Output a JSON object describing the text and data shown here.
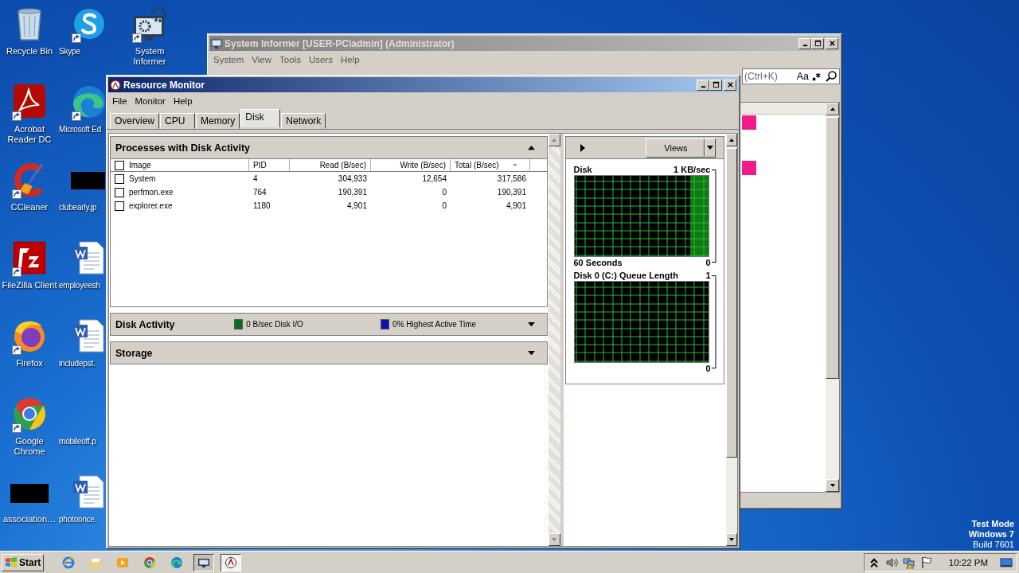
{
  "desktop_icons": [
    {
      "label": "Recycle Bin",
      "shortcut": false
    },
    {
      "label": "Acrobat Reader DC",
      "shortcut": true
    },
    {
      "label": "CCleaner",
      "shortcut": true
    },
    {
      "label": "FileZilla Client",
      "shortcut": true
    },
    {
      "label": "Firefox",
      "shortcut": true
    },
    {
      "label": "Google Chrome",
      "shortcut": true
    },
    {
      "label": "association…",
      "shortcut": false
    },
    {
      "label": "Skype",
      "shortcut": true
    },
    {
      "label": "Microsoft Ed",
      "shortcut": true
    },
    {
      "label": "clubearly.jp",
      "shortcut": false
    },
    {
      "label": "employeesh",
      "shortcut": false
    },
    {
      "label": "includepst.",
      "shortcut": false
    },
    {
      "label": "mobileoff.p",
      "shortcut": false
    },
    {
      "label": "photoonce.",
      "shortcut": false
    },
    {
      "label": "System Informer",
      "shortcut": true
    }
  ],
  "system_informer": {
    "title": "System Informer [USER-PC\\admin] (Administrator)",
    "menu": [
      "System",
      "View",
      "Tools",
      "Users",
      "Help"
    ],
    "search": {
      "placeholder": "(Ctrl+K)",
      "case_label": "Aa"
    },
    "rows": [
      {
        "highlighted": true
      },
      {
        "highlighted": false
      },
      {
        "highlighted": false
      },
      {
        "highlighted": true
      }
    ]
  },
  "resource_monitor": {
    "title": "Resource Monitor",
    "menu": [
      "File",
      "Monitor",
      "Help"
    ],
    "tabs": [
      {
        "label": "Overview",
        "selected": false
      },
      {
        "label": "CPU",
        "selected": false
      },
      {
        "label": "Memory",
        "selected": false
      },
      {
        "label": "Disk",
        "selected": true
      },
      {
        "label": "Network",
        "selected": false
      }
    ],
    "processes": {
      "title": "Processes with Disk Activity",
      "expanded": true,
      "all_checked": false,
      "columns": [
        {
          "label": "Image",
          "sorted": false
        },
        {
          "label": "PID",
          "sorted": false
        },
        {
          "label": "Read (B/sec)",
          "sorted": false
        },
        {
          "label": "Write (B/sec)",
          "sorted": false
        },
        {
          "label": "Total (B/sec)",
          "sorted": true
        }
      ],
      "rows": [
        {
          "checked": false,
          "cells": [
            "System",
            "4",
            "304,933",
            "12,654",
            "317,586"
          ]
        },
        {
          "checked": false,
          "cells": [
            "perfmon.exe",
            "764",
            "190,391",
            "0",
            "190,391"
          ]
        },
        {
          "checked": false,
          "cells": [
            "explorer.exe",
            "1180",
            "4,901",
            "0",
            "4,901"
          ]
        }
      ]
    },
    "disk_activity": {
      "title": "Disk Activity",
      "expanded": false,
      "legend": [
        {
          "label": "0 B/sec Disk I/O",
          "color": "#0b6e1e"
        },
        {
          "label": "0% Highest Active Time",
          "color": "#0a14b4"
        }
      ]
    },
    "storage": {
      "title": "Storage",
      "expanded": false
    },
    "views_button": "Views",
    "graphs": [
      {
        "title": "Disk",
        "max": "1 KB/sec",
        "span": "60 Seconds",
        "min": "0",
        "active": true
      },
      {
        "title": "Disk 0 (C:) Queue Length",
        "max": "1",
        "min": "0",
        "active": false
      }
    ]
  },
  "taskbar": {
    "start": "Start",
    "apps": [
      {
        "open": false,
        "selected": false
      },
      {
        "open": false,
        "selected": false
      },
      {
        "open": false,
        "selected": false
      },
      {
        "open": false,
        "selected": false
      },
      {
        "open": false,
        "selected": false
      },
      {
        "open": true,
        "selected": false
      },
      {
        "open": true,
        "selected": true
      }
    ],
    "clock": "10:22 PM"
  },
  "os_notice": [
    "Test Mode",
    "Windows 7",
    "Build 7601"
  ]
}
